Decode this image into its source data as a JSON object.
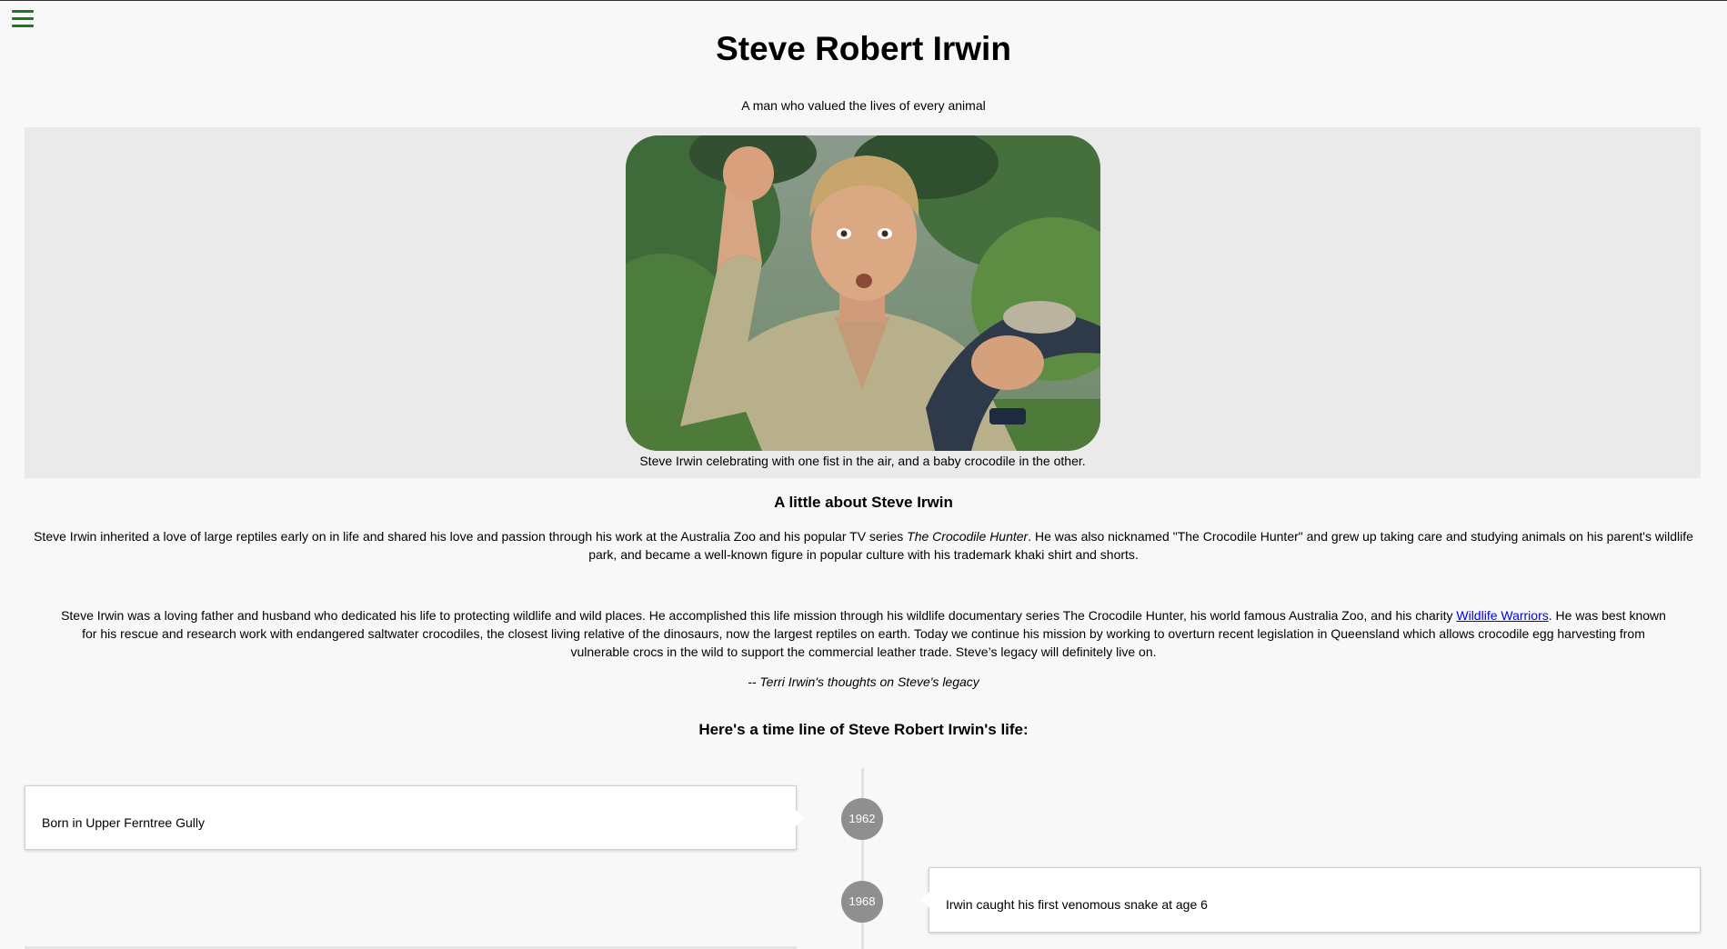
{
  "header": {
    "title": "Steve Robert Irwin",
    "tagline": "A man who valued the lives of every animal"
  },
  "hero": {
    "image_alt": "Steve Irwin celebrating with one fist in the air, and a baby crocodile in the other.",
    "caption": "Steve Irwin celebrating with one fist in the air, and a baby crocodile in the other."
  },
  "about": {
    "heading": "A little about Steve Irwin",
    "text_1": "Steve Irwin inherited a love of large reptiles early on in life and shared his love and passion through his work at the Australia Zoo and his popular TV series ",
    "show_title": "The Crocodile Hunter",
    "text_2": ". He was also nicknamed \"The Crocodile Hunter\" and grew up taking care and studying animals on his parent's wildlife park, and became a well-known figure in popular culture with his trademark khaki shirt and shorts."
  },
  "quote": {
    "text_1": "Steve Irwin was a loving father and husband who dedicated his life to protecting wildlife and wild places. He accomplished this life mission through his wildlife documentary series The Crocodile Hunter, his world famous Australia Zoo, and his charity ",
    "link_label": "Wildlife Warriors",
    "text_2": ". He was best known for his rescue and research work with endangered saltwater crocodiles, the closest living relative of the dinosaurs, now the largest reptiles on earth. Today we continue his mission by working to overturn recent legislation in Queensland which allows crocodile egg harvesting from vulnerable crocs in the wild to support the commercial leather trade. Steve’s legacy will definitely live on.",
    "attribution": "-- Terri Irwin's thoughts on Steve's legacy"
  },
  "timeline": {
    "heading": "Here's a time line of Steve Robert Irwin's life:",
    "events": [
      {
        "year": "1962",
        "text": "Born in Upper Ferntree Gully"
      },
      {
        "year": "1968",
        "text": "Irwin caught his first venomous snake at age 6"
      }
    ]
  },
  "colors": {
    "menu_icon": "#1e7a1e",
    "link": "#0000ee",
    "year_badge": "#8f8f8f",
    "image_panel": "#eaeaea"
  }
}
